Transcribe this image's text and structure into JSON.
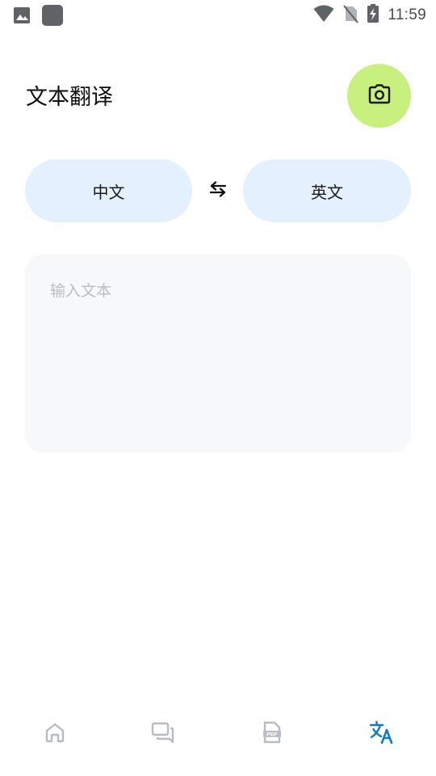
{
  "status_bar": {
    "time": "11:59",
    "icons": [
      "image-notification-icon",
      "app-notification-icon",
      "wifi-icon",
      "no-sim-icon",
      "battery-charging-icon"
    ]
  },
  "header": {
    "title": "文本翻译",
    "camera_icon": "camera-icon",
    "camera_color": "#c7f07e"
  },
  "languages": {
    "source": "中文",
    "target": "英文",
    "swap_icon": "swap-arrows-icon",
    "pill_color": "#e4f0fd"
  },
  "input": {
    "placeholder": "输入文本",
    "value": ""
  },
  "bottom_nav": {
    "items": [
      {
        "icon": "home-icon",
        "active": false
      },
      {
        "icon": "chat-icon",
        "active": false
      },
      {
        "icon": "pdf-icon",
        "active": false
      },
      {
        "icon": "translate-icon",
        "active": true
      }
    ],
    "active_color": "#1677c8",
    "inactive_color": "#b8bcc4"
  }
}
